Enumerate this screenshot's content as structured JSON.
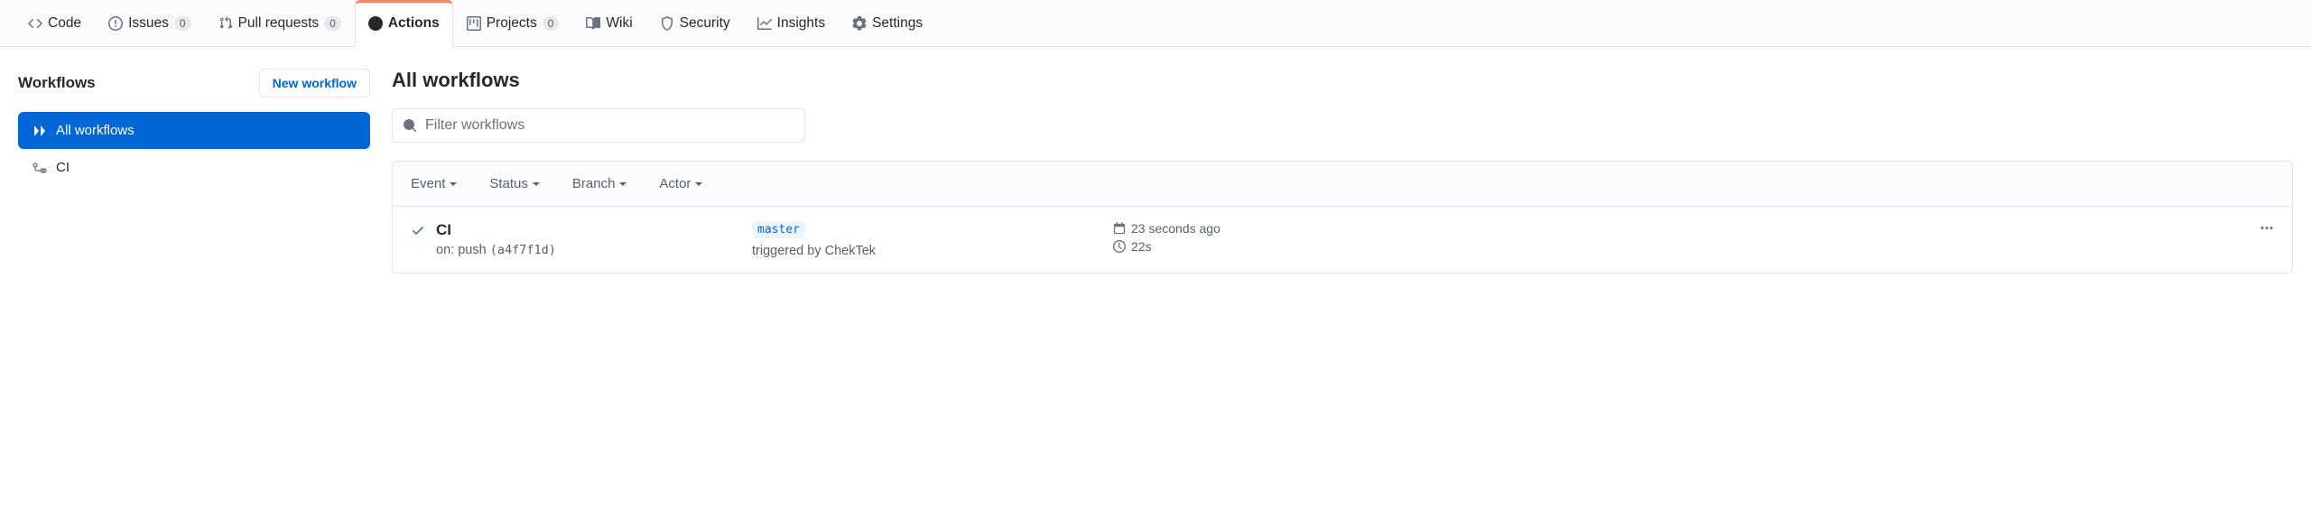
{
  "tabs": {
    "code": "Code",
    "issues": "Issues",
    "issues_count": "0",
    "pull_requests": "Pull requests",
    "pull_requests_count": "0",
    "actions": "Actions",
    "projects": "Projects",
    "projects_count": "0",
    "wiki": "Wiki",
    "security": "Security",
    "insights": "Insights",
    "settings": "Settings"
  },
  "sidebar": {
    "heading": "Workflows",
    "new_button": "New workflow",
    "all_workflows": "All workflows",
    "items": [
      {
        "label": "CI"
      }
    ]
  },
  "content": {
    "heading": "All workflows",
    "filter_placeholder": "Filter workflows",
    "filters": {
      "event": "Event",
      "status": "Status",
      "branch": "Branch",
      "actor": "Actor"
    },
    "run": {
      "title": "CI",
      "on_prefix": "on:",
      "event": "push",
      "sha_open": "(",
      "sha": "a4f7f1d",
      "sha_close": ")",
      "branch": "master",
      "triggered_prefix": "triggered by",
      "triggered_user": "ChekTek",
      "time_ago": "23 seconds ago",
      "duration": "22s"
    }
  }
}
